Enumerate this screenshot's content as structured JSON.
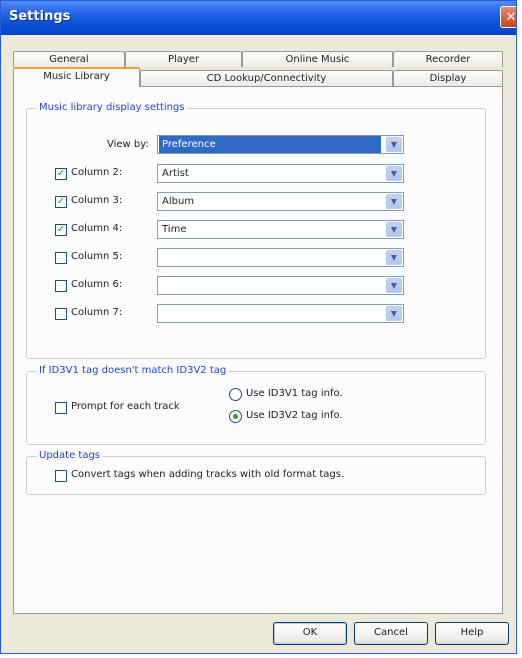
{
  "window": {
    "title": "Settings",
    "close_glyph": "✕"
  },
  "tabs": {
    "row_back": [
      "General",
      "Player",
      "Online Music",
      "Recorder"
    ],
    "row_front": [
      "Music Library",
      "CD Lookup/Connectivity",
      "Display"
    ],
    "active": "Music Library"
  },
  "display_settings": {
    "legend": "Music library display settings",
    "view_by": {
      "label": "View by:",
      "value": "Preference"
    },
    "columns": [
      {
        "label": "Column 2:",
        "checked": true,
        "value": "Artist"
      },
      {
        "label": "Column 3:",
        "checked": true,
        "value": "Album"
      },
      {
        "label": "Column 4:",
        "checked": true,
        "value": "Time"
      },
      {
        "label": "Column 5:",
        "checked": false,
        "value": ""
      },
      {
        "label": "Column 6:",
        "checked": false,
        "value": ""
      },
      {
        "label": "Column 7:",
        "checked": false,
        "value": ""
      }
    ]
  },
  "id3_mismatch": {
    "legend": "If ID3V1 tag doesn't match ID3V2 tag",
    "prompt": {
      "label": "Prompt for each track",
      "checked": false
    },
    "option_v1": {
      "label": "Use ID3V1 tag info.",
      "selected": false
    },
    "option_v2": {
      "label": "Use ID3V2 tag info.",
      "selected": true
    }
  },
  "update_tags": {
    "legend": "Update tags",
    "convert": {
      "label": "Convert tags when adding tracks with old format tags.",
      "checked": false
    }
  },
  "buttons": {
    "ok": "OK",
    "cancel": "Cancel",
    "help": "Help"
  },
  "icons": {
    "checkmark": "✓",
    "dropdown": "▼"
  },
  "colors": {
    "titlebar": "#0a4fd6",
    "legend_text": "#1b46c8",
    "selection": "#316ac5",
    "check": "#21a121"
  }
}
